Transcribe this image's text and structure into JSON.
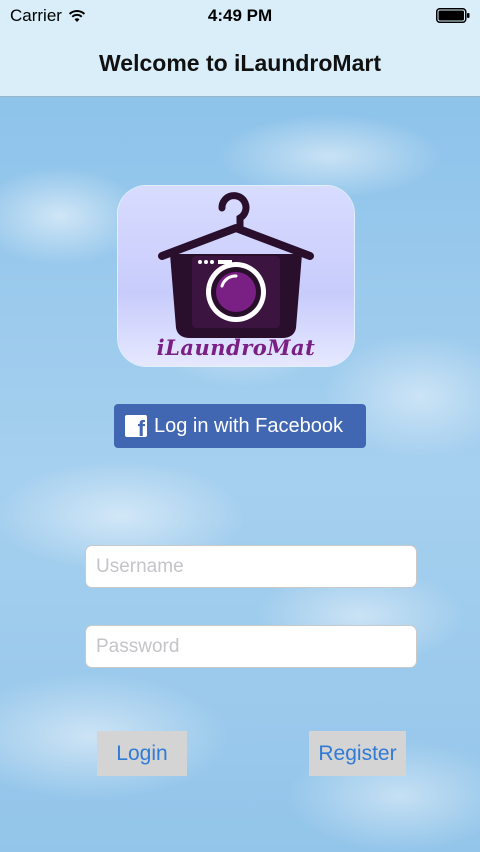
{
  "status_bar": {
    "carrier": "Carrier",
    "time": "4:49 PM"
  },
  "nav": {
    "title": "Welcome to iLaundroMart"
  },
  "logo": {
    "text": "iLaundroMat"
  },
  "facebook": {
    "label": "Log in with Facebook",
    "icon": "facebook-f-icon"
  },
  "form": {
    "username_placeholder": "Username",
    "password_placeholder": "Password"
  },
  "buttons": {
    "login": "Login",
    "register": "Register"
  },
  "colors": {
    "nav_bg": "#d9eef9",
    "facebook_blue": "#4267b2",
    "button_text": "#2f7bd6",
    "logo_purple": "#7a1f84"
  }
}
